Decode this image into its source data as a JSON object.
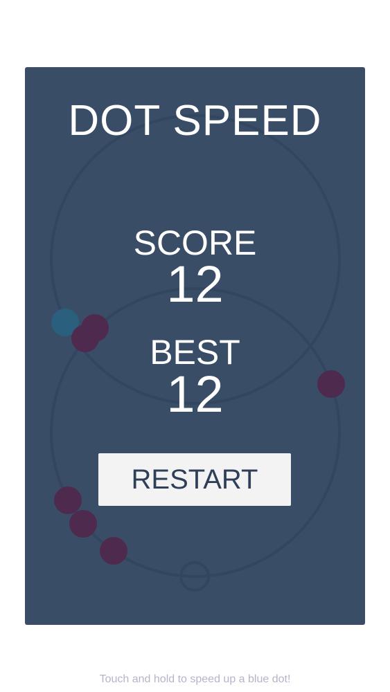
{
  "game": {
    "title": "DOT SPEED",
    "score_label": "SCORE",
    "score": "12",
    "best_label": "BEST",
    "best": "12",
    "restart_label": "RESTART",
    "hint": "Touch and hold to speed up a blue dot!"
  },
  "colors": {
    "page_background": "#ffffff",
    "panel_background": "#3a4d67",
    "track": "#33465f",
    "blue_dot": "#2b5f7e",
    "enemy_dot": "#4e2a4e",
    "text": "#ffffff",
    "button_background": "#f3f3f4",
    "button_text": "#2f3f58",
    "hint_text": "#b7b3c8"
  }
}
